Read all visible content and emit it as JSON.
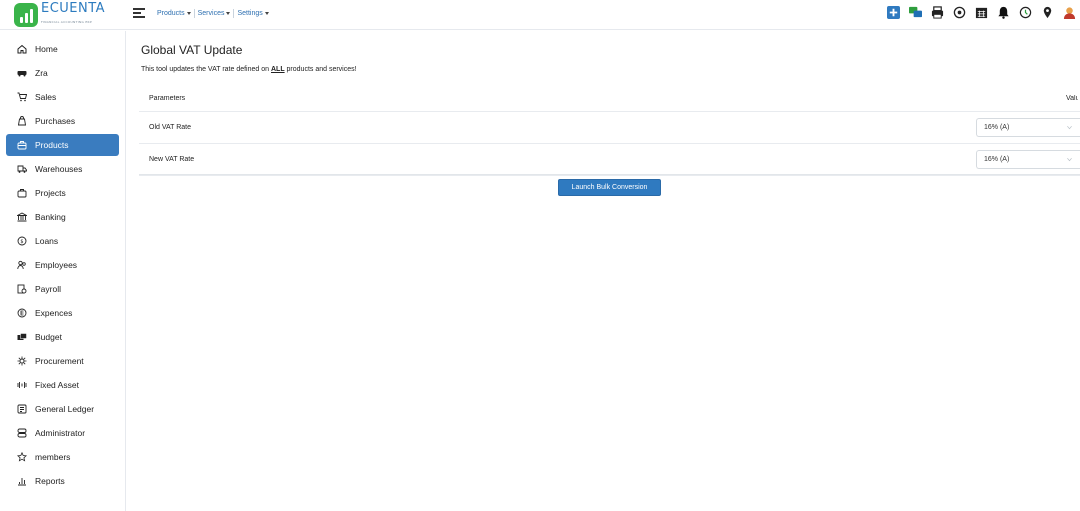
{
  "brand": {
    "name": "ECUENTA",
    "tagline": "FINANCIAL ACCOUNTING ERP",
    "color": "#2c7bbf",
    "mark_color": "#3ab44a"
  },
  "topbar": {
    "menus": [
      {
        "label": "Products"
      },
      {
        "label": "Services"
      },
      {
        "label": "Settings"
      }
    ],
    "icons": [
      "add-icon",
      "chat-icon",
      "printer-icon",
      "settings-icon",
      "calendar-icon",
      "bell-icon",
      "history-icon",
      "location-icon",
      "user-avatar-icon"
    ]
  },
  "sidebar": {
    "active_color": "#3a7cbf",
    "items": [
      {
        "label": "Home",
        "icon": "home-icon"
      },
      {
        "label": "Zra",
        "icon": "cars-icon"
      },
      {
        "label": "Sales",
        "icon": "cart-icon"
      },
      {
        "label": "Purchases",
        "icon": "bag-icon"
      },
      {
        "label": "Products",
        "icon": "box-icon",
        "active": true
      },
      {
        "label": "Warehouses",
        "icon": "truck-icon"
      },
      {
        "label": "Projects",
        "icon": "briefcase-icon"
      },
      {
        "label": "Banking",
        "icon": "bank-icon"
      },
      {
        "label": "Loans",
        "icon": "dollar-coin-icon"
      },
      {
        "label": "Employees",
        "icon": "people-icon"
      },
      {
        "label": "Payroll",
        "icon": "payroll-icon"
      },
      {
        "label": "Expences",
        "icon": "expense-icon"
      },
      {
        "label": "Budget",
        "icon": "money-icon"
      },
      {
        "label": "Procurement",
        "icon": "procurement-icon"
      },
      {
        "label": "Fixed Asset",
        "icon": "asset-icon"
      },
      {
        "label": "General Ledger",
        "icon": "ledger-icon"
      },
      {
        "label": "Administrator",
        "icon": "admin-icon"
      },
      {
        "label": "members",
        "icon": "star-icon"
      },
      {
        "label": "Reports",
        "icon": "chart-icon"
      }
    ]
  },
  "main": {
    "title": "Global VAT Update",
    "description_prefix": "This tool updates the VAT rate defined on ",
    "description_emphasis": "ALL",
    "description_suffix": " products and services!",
    "table": {
      "header_parameters": "Parameters",
      "header_value": "Value",
      "rows": [
        {
          "label": "Old VAT Rate",
          "value": "16% (A)"
        },
        {
          "label": "New VAT Rate",
          "value": "16% (A)"
        }
      ]
    },
    "button_label": "Launch Bulk Conversion"
  }
}
